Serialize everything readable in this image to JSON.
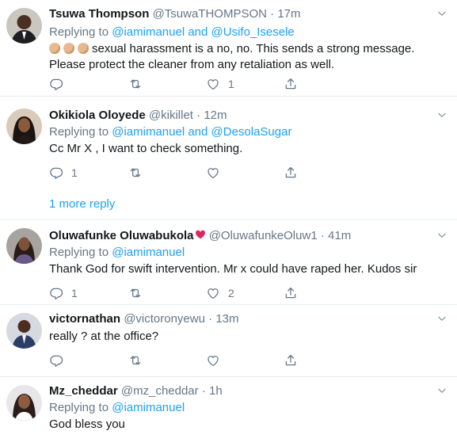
{
  "tweets": [
    {
      "name": "Tsuwa Thompson",
      "handle": "@TsuwaTHOMPSON",
      "time": "17m",
      "replying_prefix": "Replying to",
      "replying_to": "@iamimanuel and @Usifo_Isesele",
      "text": "sexual harassment is a no, no. This sends a strong message. Please protect the cleaner from any retaliation as well.",
      "reply_count": "",
      "retweet_count": "",
      "like_count": "1"
    },
    {
      "name": "Okikiola Oloyede",
      "handle": "@kikillet",
      "time": "12m",
      "replying_prefix": "Replying to",
      "replying_to": "@iamimanuel and @DesolaSugar",
      "text": "Cc Mr X , I want to check something.",
      "reply_count": "1",
      "retweet_count": "",
      "like_count": ""
    },
    {
      "name": "Oluwafunke Oluwabukola",
      "handle": "@OluwafunkeOluw1",
      "time": "41m",
      "replying_prefix": "Replying to",
      "replying_to": "@iamimanuel",
      "text": "Thank God for swift intervention. Mr x could have raped her. Kudos sir",
      "reply_count": "1",
      "retweet_count": "",
      "like_count": "2"
    },
    {
      "name": "victornathan",
      "handle": "@victoronyewu",
      "time": "13m",
      "text": "really ? at the office?",
      "reply_count": "",
      "retweet_count": "",
      "like_count": ""
    },
    {
      "name": "Mz_cheddar",
      "handle": "@mz_cheddar",
      "time": "1h",
      "replying_prefix": "Replying to",
      "replying_to": "@iamimanuel",
      "text": "God bless you"
    }
  ],
  "more_replies_label": "1 more reply",
  "dot": "·",
  "colors": {
    "link": "#1da1f2",
    "muted": "#657786",
    "text": "#14171a",
    "border": "#e6ecf0",
    "clap": "#e8b98f",
    "heart": "#e0245e"
  },
  "icons": [
    "reply-icon",
    "retweet-icon",
    "like-icon",
    "share-icon",
    "chevron-down-icon",
    "clapping-hands-icon",
    "hearts-icon"
  ]
}
